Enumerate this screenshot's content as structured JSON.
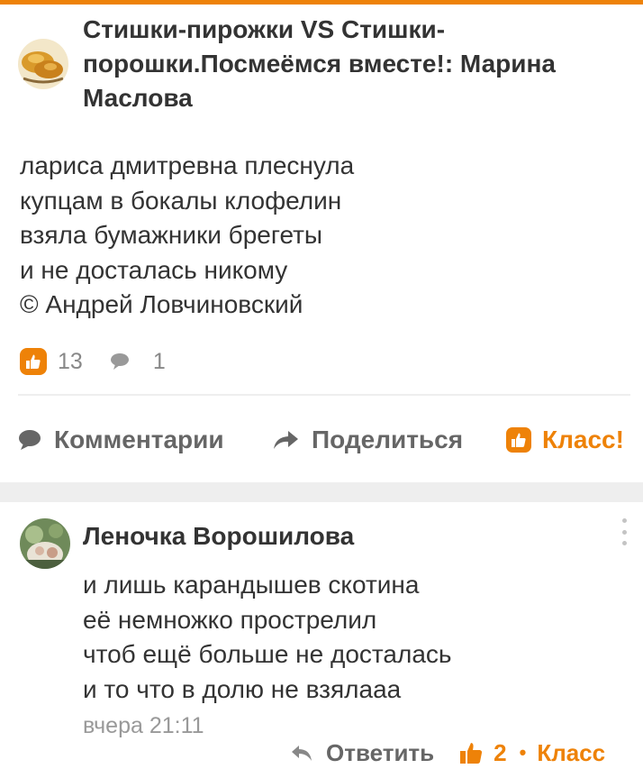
{
  "post": {
    "title": "Стишки-пирожки VS Стишки-порошки.Посмеёмся вместе!: Марина Маслова",
    "lines": [
      "лариса дмитревна плеснула",
      "купцам в бокалы клофелин",
      "взяла бумажники брегеты",
      "и не досталась никому",
      "© Андрей Ловчиновский"
    ],
    "like_count": "13",
    "comment_count": "1"
  },
  "actions": {
    "comments_label": "Комментарии",
    "share_label": "Поделиться",
    "like_label": "Класс!"
  },
  "comment": {
    "author": "Леночка Ворошилова",
    "lines": [
      "и лишь карандышев скотина",
      "её немножко прострелил",
      "чтоб ещё больше не досталась",
      "и то что в долю не взялааа"
    ],
    "time": "вчера 21:11",
    "reply_label": "Ответить",
    "like_count": "2",
    "separator": "•",
    "klass_label": "Класс"
  },
  "colors": {
    "accent": "#ee8208",
    "text": "#333333",
    "muted": "#888888"
  }
}
